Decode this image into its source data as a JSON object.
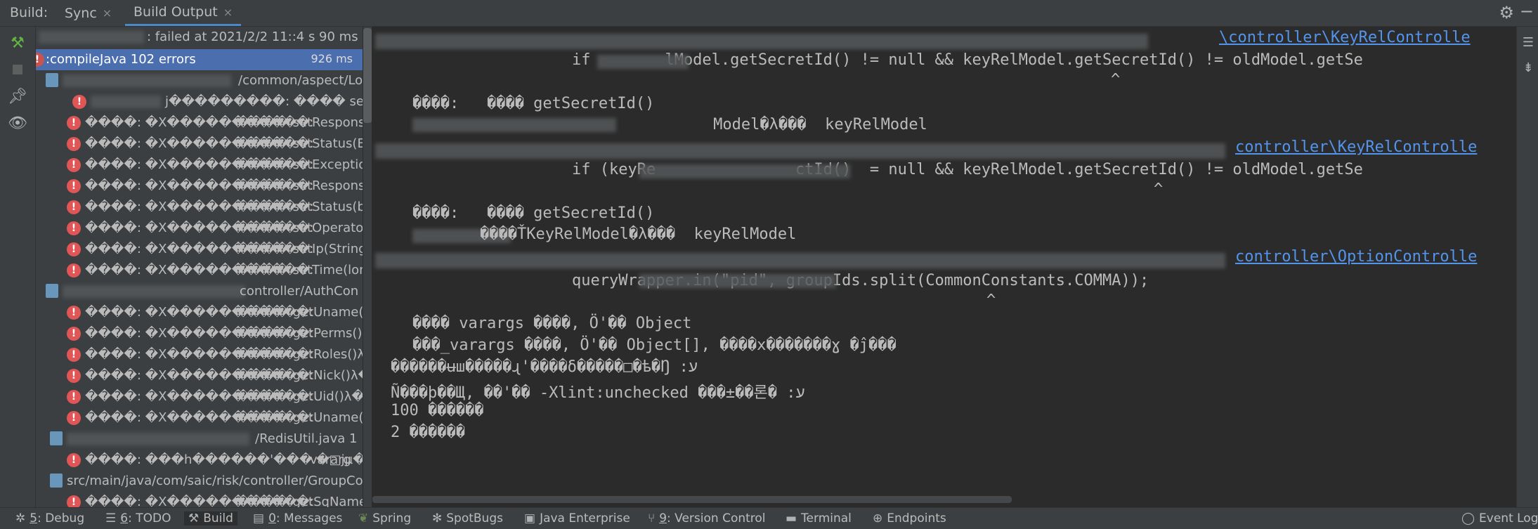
{
  "header": {
    "build_label": "Build:",
    "tabs": [
      {
        "label": "Sync",
        "close": "×"
      },
      {
        "label": "Build Output",
        "close": "×"
      }
    ],
    "settings_icon": "gear-icon",
    "minimize_icon": "minus-icon"
  },
  "tree": {
    "compile": {
      "label": ":compileJava  102 errors",
      "duration": "926 ms"
    },
    "root_status": ": failed at 2021/2/2 11::4 s 90 ms",
    "files": [
      {
        "path": "/common/aspect/Lo"
      },
      {
        "path": "controller/AuthCon"
      },
      {
        "path": "/RedisUtil.java  1"
      },
      {
        "path": "src/main/java/com/saic/risk/controller/GroupCo"
      }
    ],
    "errors_group1": [
      {
        "prefix": "",
        "text": "j���������:   ���� setException(S"
      },
      {
        "prefix": "����: �X�����������:",
        "text": "���� setResponse(S"
      },
      {
        "prefix": "����: �X�����������:",
        "text": "���� setStatus(Bool"
      },
      {
        "prefix": "����: �X�����������:",
        "text": "���� setException(S"
      },
      {
        "prefix": "����: �X�����������:",
        "text": "���� setResponseM"
      },
      {
        "prefix": "����: �X�����������:",
        "text": "���� setStatus(bool"
      },
      {
        "prefix": "����: �X�����������:",
        "text": "���� setOperator(St"
      },
      {
        "prefix": "����: �X�����������:",
        "text": "���� setIp(String)λ�"
      },
      {
        "prefix": "����: �X�����������:",
        "text": "���� setTime(long)λ"
      }
    ],
    "errors_group2": [
      {
        "prefix": "����: �X�����������:",
        "text": "���� getUname()λ��"
      },
      {
        "prefix": "����: �X�����������:",
        "text": "���� getPerms()λ��"
      },
      {
        "prefix": "����: �X�����������:",
        "text": "���� getRoles()λ��:"
      },
      {
        "prefix": "����: �X�����������:",
        "text": "���� getNick()λ��: l"
      },
      {
        "prefix": "����: �X�����������:",
        "text": "���� getUid()λ��: ι"
      },
      {
        "prefix": "����: �X�����������:",
        "text": "���� getUname()λ�"
      }
    ],
    "errors_group3": [
      {
        "prefix": "����: ���h������'���  �□jµ��������  �",
        "text": "  vararg"
      }
    ],
    "errors_group4": [
      {
        "prefix": "����: �X�����������:",
        "text": "���� getSqName()λ"
      }
    ]
  },
  "console": {
    "links": [
      "\\controller\\KeyRelControlle",
      "controller\\KeyRelControlle",
      "controller\\OptionControlle"
    ],
    "lines": [
      "if        lModel.getSecretId() != null && keyRelModel.getSecretId() != oldModel.getSe",
      "����:   ���� getSecretId()",
      "                 Model�λ���  keyRelModel",
      "if (keyRe               ctId()  = null && keyRelModel.getSecretId() != oldModel.getSe",
      "����:   ���� getSecretId()",
      "    ����ŤKeyRelModel�λ���  keyRelModel",
      "queryWrapper.in(\"pid\", groupIds.split(CommonConstants.COMMA));",
      "���� varargs ����, Ö'�� Object",
      "���_varargs ����, Ö'�� Object[], ����x�������ɣ �ĵ���",
      "������ʉш�����ɻ'����δ�����□�ѣ�Ŋ :ע",
      "Ñ���þ��Щ, ��'�� -Xlint:unchecked ���±��론� :ע",
      "100 ������",
      "2 ������"
    ],
    "caret": "^"
  },
  "right_icons": [
    "wrap-icon",
    "scroll-end-icon"
  ],
  "statusbar": {
    "items": [
      {
        "key": "5",
        "label": ": Debug",
        "icon": "debug-icon"
      },
      {
        "key": "6",
        "label": ": TODO",
        "icon": "todo-icon"
      },
      {
        "key": "",
        "label": "Build",
        "icon": "hammer-icon"
      },
      {
        "key": "0",
        "label": ": Messages",
        "icon": "messages-icon"
      },
      {
        "key": "",
        "label": "Spring",
        "icon": "spring-icon"
      },
      {
        "key": "",
        "label": "SpotBugs",
        "icon": "bug-icon"
      },
      {
        "key": "",
        "label": "Java Enterprise",
        "icon": "enterprise-icon"
      },
      {
        "key": "9",
        "label": ": Version Control",
        "icon": "vcs-icon"
      },
      {
        "key": "",
        "label": "Terminal",
        "icon": "terminal-icon"
      },
      {
        "key": "",
        "label": "Endpoints",
        "icon": "endpoints-icon"
      }
    ],
    "event_log": "Event Log"
  }
}
